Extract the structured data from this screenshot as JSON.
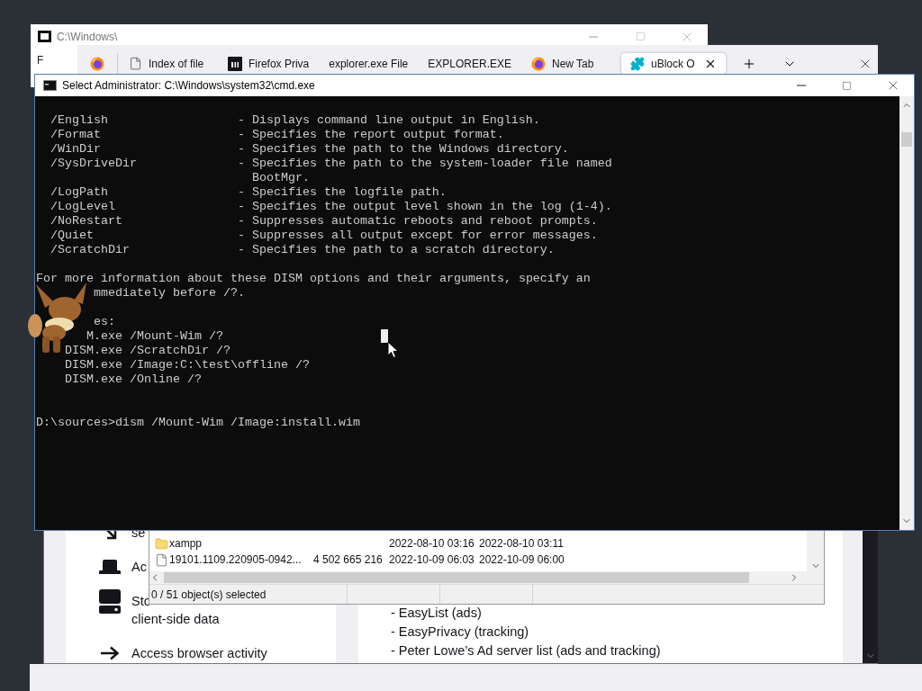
{
  "archive_window": {
    "title": "C:\\Windows\\",
    "menu": [
      "F"
    ],
    "file_list": {
      "rows": [
        {
          "kind": "folder",
          "column_1": "xampp",
          "column_3": "2022-08-10 03:16",
          "column_4": "2022-08-10 03:11"
        },
        {
          "kind": "file",
          "column_1": "19101.1109.220905-0942...",
          "column_2": "4 502 665 216",
          "column_3": "2022-10-09 06:03",
          "column_4": "2022-10-09 06:00"
        }
      ],
      "status_bar": "0 / 51 object(s) selected"
    }
  },
  "browser": {
    "tabs": [
      {
        "label": "Index of file",
        "selected": false
      },
      {
        "label": "Firefox Priva",
        "selected": false
      },
      {
        "label": "explorer.exe File",
        "selected": false
      },
      {
        "label": "EXPLORER.EXE",
        "selected": false
      },
      {
        "label": "New Tab",
        "selected": false
      },
      {
        "label": "uBlock O",
        "selected": true
      }
    ],
    "permissions": [
      {
        "lines": [
          "se"
        ]
      },
      {
        "lines": [
          "Ac"
        ]
      },
      {
        "lines": [
          "Sto",
          "client-side data"
        ]
      },
      {
        "lines": [
          "Access browser activity"
        ]
      }
    ],
    "filter_lists": [
      "- EasyList (ads)",
      "- EasyPrivacy (tracking)",
      "- Peter Lowe’s Ad server list (ads and tracking)"
    ]
  },
  "console_window": {
    "title": "Select Administrator: C:\\Windows\\system32\\cmd.exe",
    "options": [
      {
        "kind": "option",
        "option": "/English",
        "description": "- Displays command line output in English."
      },
      {
        "kind": "option",
        "option": "/Format",
        "description": "- Specifies the report output format."
      },
      {
        "kind": "option",
        "option": "/WinDir",
        "description": "- Specifies the path to the Windows directory."
      },
      {
        "kind": "option",
        "option": "/SysDriveDir",
        "description": "- Specifies the path to the system-loader file named"
      },
      {
        "kind": "continuation",
        "description": "BootMgr."
      },
      {
        "kind": "option",
        "option": "/LogPath",
        "description": "- Specifies the logfile path."
      },
      {
        "kind": "option",
        "option": "/LogLevel",
        "description": "- Specifies the output level shown in the log (1-4)."
      },
      {
        "kind": "option",
        "option": "/NoRestart",
        "description": "- Suppresses automatic reboots and reboot prompts."
      },
      {
        "kind": "option",
        "option": "/Quiet",
        "description": "- Suppresses all output except for error messages."
      },
      {
        "kind": "option",
        "option": "/ScratchDir",
        "description": "- Specifies the path to a scratch directory."
      }
    ],
    "notes": [
      "For more information about these DISM options and their arguments, specify an",
      "        mmediately before /?."
    ],
    "examples": [
      "        es:",
      "       M.exe /Mount-Wim /?",
      "    DISM.exe /ScratchDir /?",
      "    DISM.exe /Image:C:\\test\\offline /?",
      "    DISM.exe /Online /?"
    ],
    "command_line": "D:\\sources>dism /Mount-Wim /Image:install.wim"
  }
}
